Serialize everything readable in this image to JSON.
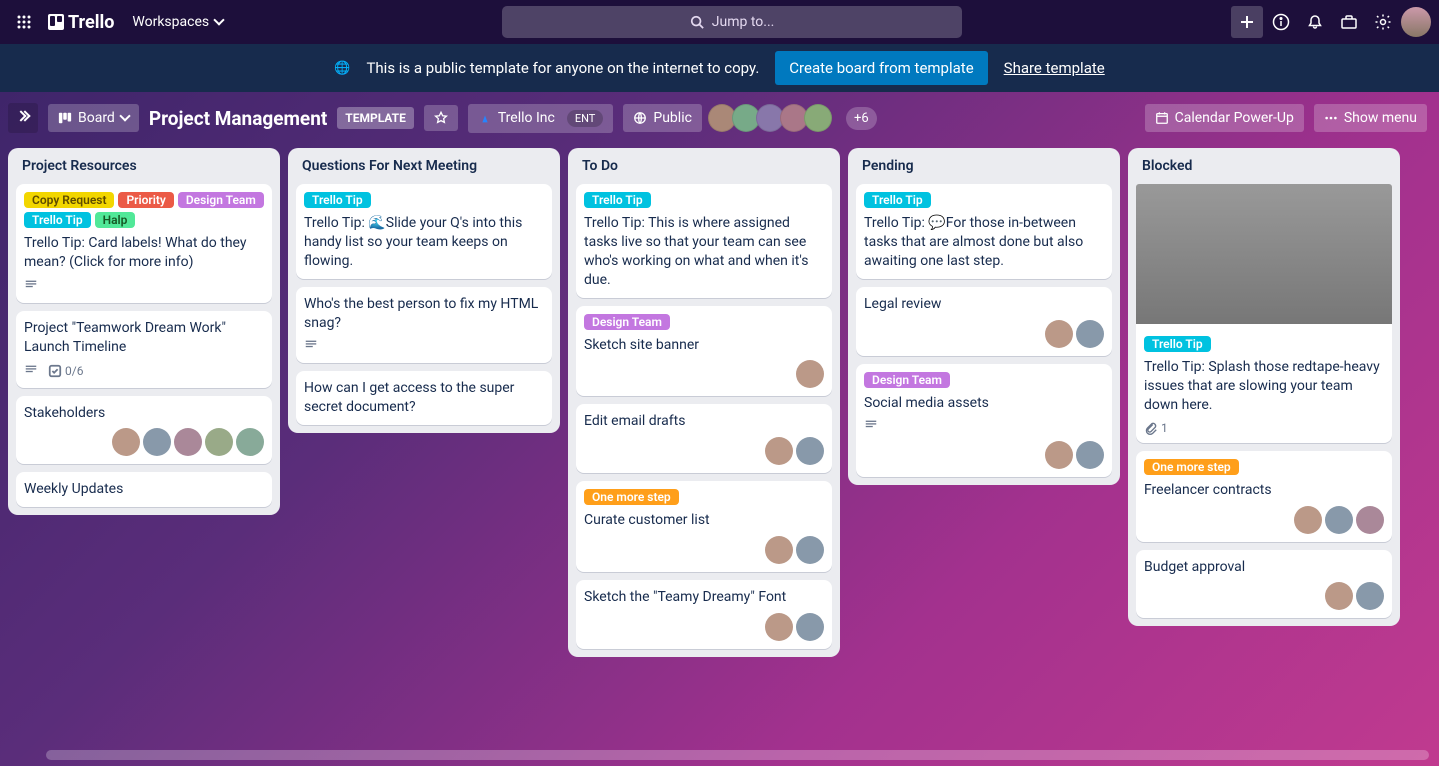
{
  "nav": {
    "logo_text": "Trello",
    "workspaces_label": "Workspaces",
    "search_placeholder": "Jump to..."
  },
  "banner": {
    "text": "This is a public template for anyone on the internet to copy.",
    "create_label": "Create board from template",
    "share_label": "Share template"
  },
  "board_header": {
    "view_label": "Board",
    "title": "Project Management",
    "template_badge": "TEMPLATE",
    "workspace_name": "Trello Inc",
    "ent_badge": "ENT",
    "visibility": "Public",
    "extra_members": "+6",
    "calendar_label": "Calendar Power-Up",
    "menu_label": "Show menu"
  },
  "label_colors": {
    "copy_request": {
      "text": "Copy Request",
      "bg": "#f2d600",
      "fg": "#5e4b00"
    },
    "priority": {
      "text": "Priority",
      "bg": "#eb5a46",
      "fg": "#fff"
    },
    "design_team": {
      "text": "Design Team",
      "bg": "#c377e0",
      "fg": "#fff"
    },
    "trello_tip": {
      "text": "Trello Tip",
      "bg": "#00c2e0",
      "fg": "#fff"
    },
    "halp": {
      "text": "Halp",
      "bg": "#51e898",
      "fg": "#155724"
    },
    "one_more_step": {
      "text": "One more step",
      "bg": "#ff9f1a",
      "fg": "#fff"
    }
  },
  "lists": [
    {
      "title": "Project Resources",
      "cards": [
        {
          "labels": [
            "copy_request",
            "priority",
            "design_team",
            "trello_tip",
            "halp"
          ],
          "text": "Trello Tip: Card labels! What do they mean? (Click for more info)",
          "badges": {
            "desc": true
          }
        },
        {
          "text": "Project \"Teamwork Dream Work\" Launch Timeline",
          "badges": {
            "desc": true,
            "checklist": "0/6"
          }
        },
        {
          "text": "Stakeholders",
          "members": 5
        },
        {
          "text": "Weekly Updates"
        }
      ]
    },
    {
      "title": "Questions For Next Meeting",
      "cards": [
        {
          "labels": [
            "trello_tip"
          ],
          "text": "Trello Tip: 🌊Slide your Q's into this handy list so your team keeps on flowing."
        },
        {
          "text": "Who's the best person to fix my HTML snag?",
          "badges": {
            "desc": true
          }
        },
        {
          "text": "How can I get access to the super secret document?"
        }
      ]
    },
    {
      "title": "To Do",
      "cards": [
        {
          "labels": [
            "trello_tip"
          ],
          "text": "Trello Tip: This is where assigned tasks live so that your team can see who's working on what and when it's due."
        },
        {
          "labels": [
            "design_team"
          ],
          "text": "Sketch site banner",
          "members": 1
        },
        {
          "text": "Edit email drafts",
          "members": 2
        },
        {
          "labels": [
            "one_more_step"
          ],
          "text": "Curate customer list",
          "members": 2
        },
        {
          "text": "Sketch the \"Teamy Dreamy\" Font",
          "members": 2
        }
      ]
    },
    {
      "title": "Pending",
      "cards": [
        {
          "labels": [
            "trello_tip"
          ],
          "text": "Trello Tip: 💬For those in-between tasks that are almost done but also awaiting one last step."
        },
        {
          "text": "Legal review",
          "members": 2
        },
        {
          "labels": [
            "design_team"
          ],
          "text": "Social media assets",
          "badges": {
            "desc": true
          },
          "members": 2
        }
      ]
    },
    {
      "title": "Blocked",
      "cards": [
        {
          "image": true,
          "labels": [
            "trello_tip"
          ],
          "text": "Trello Tip: Splash those redtape-heavy issues that are slowing your team down here.",
          "badges": {
            "attach": "1"
          }
        },
        {
          "labels": [
            "one_more_step"
          ],
          "text": "Freelancer contracts",
          "members": 3
        },
        {
          "text": "Budget approval",
          "members": 2
        }
      ]
    }
  ]
}
